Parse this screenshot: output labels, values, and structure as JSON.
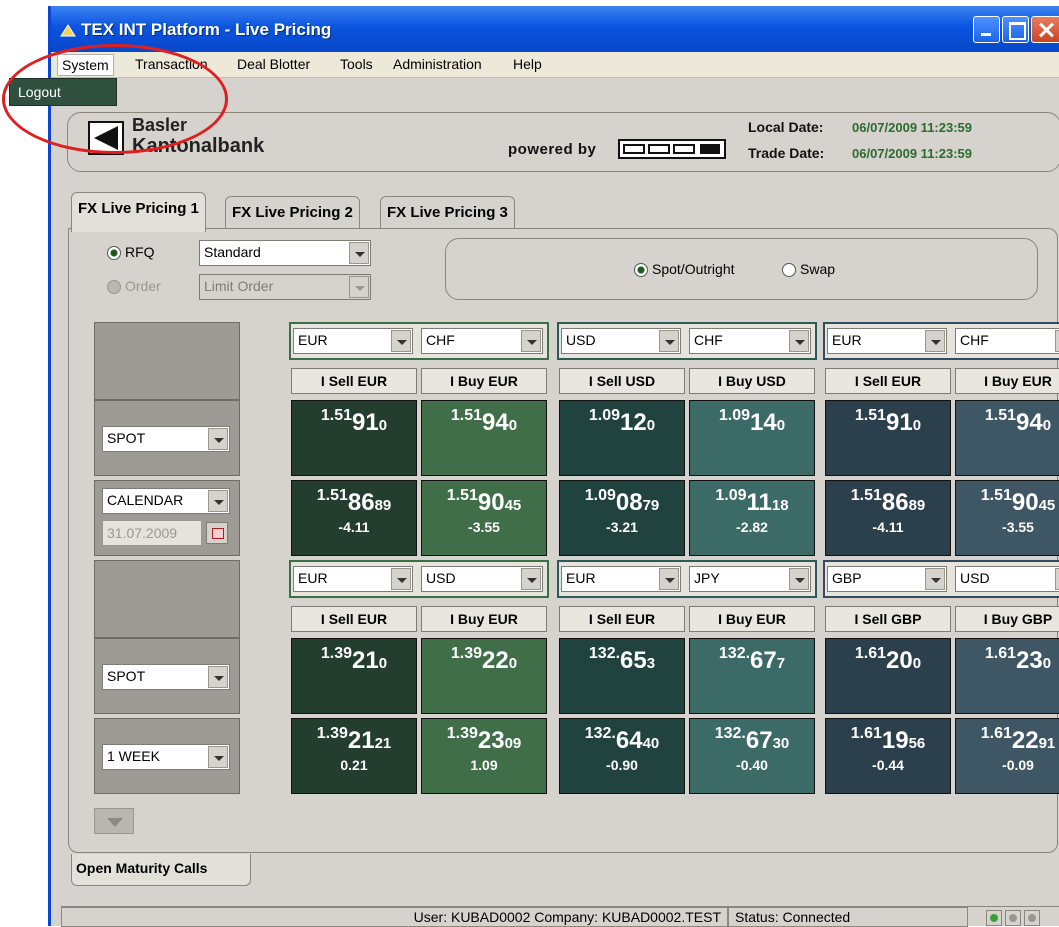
{
  "window": {
    "title": "TEX INT Platform - Live Pricing"
  },
  "menu": {
    "items": [
      "System",
      "Transaction",
      "Deal Blotter",
      "Tools",
      "Administration",
      "Help"
    ],
    "open_item": "Logout"
  },
  "header": {
    "bank_line1": "Basler",
    "bank_line2": "Kantonalbank",
    "powered_by": "powered by",
    "local_date_label": "Local Date:",
    "local_date_value": "06/07/2009 11:23:59",
    "trade_date_label": "Trade Date:",
    "trade_date_value": "06/07/2009 11:23:59"
  },
  "tabs": [
    "FX Live Pricing 1",
    "FX Live Pricing 2",
    "FX Live Pricing 3"
  ],
  "order_type": {
    "rfq_label": "RFQ",
    "rfq_value": "Standard",
    "order_label": "Order",
    "order_value": "Limit Order"
  },
  "deal_type": {
    "spot_label": "Spot/Outright",
    "swap_label": "Swap",
    "selected": "Spot/Outright"
  },
  "grid": {
    "rows": [
      {
        "pairs": [
          {
            "base": "EUR",
            "quote": "CHF",
            "sell_label": "I Sell EUR",
            "buy_label": "I Buy EUR"
          },
          {
            "base": "USD",
            "quote": "CHF",
            "sell_label": "I Sell USD",
            "buy_label": "I Buy USD"
          },
          {
            "base": "EUR",
            "quote": "CHF",
            "sell_label": "I Sell EUR",
            "buy_label": "I Buy EUR"
          }
        ],
        "tenors": [
          {
            "tenor": "SPOT",
            "quotes": [
              {
                "sell": {
                  "big": "1.51",
                  "main": "91",
                  "small": "0"
                },
                "buy": {
                  "big": "1.51",
                  "main": "94",
                  "small": "0"
                }
              },
              {
                "sell": {
                  "big": "1.09",
                  "main": "12",
                  "small": "0"
                },
                "buy": {
                  "big": "1.09",
                  "main": "14",
                  "small": "0"
                }
              },
              {
                "sell": {
                  "big": "1.51",
                  "main": "91",
                  "small": "0"
                },
                "buy": {
                  "big": "1.51",
                  "main": "94",
                  "small": "0"
                }
              }
            ]
          },
          {
            "tenor": "CALENDAR",
            "date": "31.07.2009",
            "quotes": [
              {
                "sell": {
                  "big": "1.51",
                  "main": "86",
                  "small": "89",
                  "points": "-4.11"
                },
                "buy": {
                  "big": "1.51",
                  "main": "90",
                  "small": "45",
                  "points": "-3.55"
                }
              },
              {
                "sell": {
                  "big": "1.09",
                  "main": "08",
                  "small": "79",
                  "points": "-3.21"
                },
                "buy": {
                  "big": "1.09",
                  "main": "11",
                  "small": "18",
                  "points": "-2.82"
                }
              },
              {
                "sell": {
                  "big": "1.51",
                  "main": "86",
                  "small": "89",
                  "points": "-4.11"
                },
                "buy": {
                  "big": "1.51",
                  "main": "90",
                  "small": "45",
                  "points": "-3.55"
                }
              }
            ]
          }
        ]
      },
      {
        "pairs": [
          {
            "base": "EUR",
            "quote": "USD",
            "sell_label": "I Sell EUR",
            "buy_label": "I Buy EUR"
          },
          {
            "base": "EUR",
            "quote": "JPY",
            "sell_label": "I Sell EUR",
            "buy_label": "I Buy EUR"
          },
          {
            "base": "GBP",
            "quote": "USD",
            "sell_label": "I Sell GBP",
            "buy_label": "I Buy GBP"
          }
        ],
        "tenors": [
          {
            "tenor": "SPOT",
            "quotes": [
              {
                "sell": {
                  "big": "1.39",
                  "main": "21",
                  "small": "0"
                },
                "buy": {
                  "big": "1.39",
                  "main": "22",
                  "small": "0"
                }
              },
              {
                "sell": {
                  "big": "132.",
                  "main": "65",
                  "small": "3"
                },
                "buy": {
                  "big": "132.",
                  "main": "67",
                  "small": "7"
                }
              },
              {
                "sell": {
                  "big": "1.61",
                  "main": "20",
                  "small": "0"
                },
                "buy": {
                  "big": "1.61",
                  "main": "23",
                  "small": "0"
                }
              }
            ]
          },
          {
            "tenor": "1 WEEK",
            "quotes": [
              {
                "sell": {
                  "big": "1.39",
                  "main": "21",
                  "small": "21",
                  "points": "0.21"
                },
                "buy": {
                  "big": "1.39",
                  "main": "23",
                  "small": "09",
                  "points": "1.09"
                }
              },
              {
                "sell": {
                  "big": "132.",
                  "main": "64",
                  "small": "40",
                  "points": "-0.90"
                },
                "buy": {
                  "big": "132.",
                  "main": "67",
                  "small": "30",
                  "points": "-0.40"
                }
              },
              {
                "sell": {
                  "big": "1.61",
                  "main": "19",
                  "small": "56",
                  "points": "-0.44"
                },
                "buy": {
                  "big": "1.61",
                  "main": "22",
                  "small": "91",
                  "points": "-0.09"
                }
              }
            ]
          }
        ]
      }
    ]
  },
  "bottom_tab": "Open Maturity Calls",
  "status": {
    "user": "User: KUBAD0002 Company: KUBAD0002.TEST",
    "connection": "Status:  Connected"
  }
}
